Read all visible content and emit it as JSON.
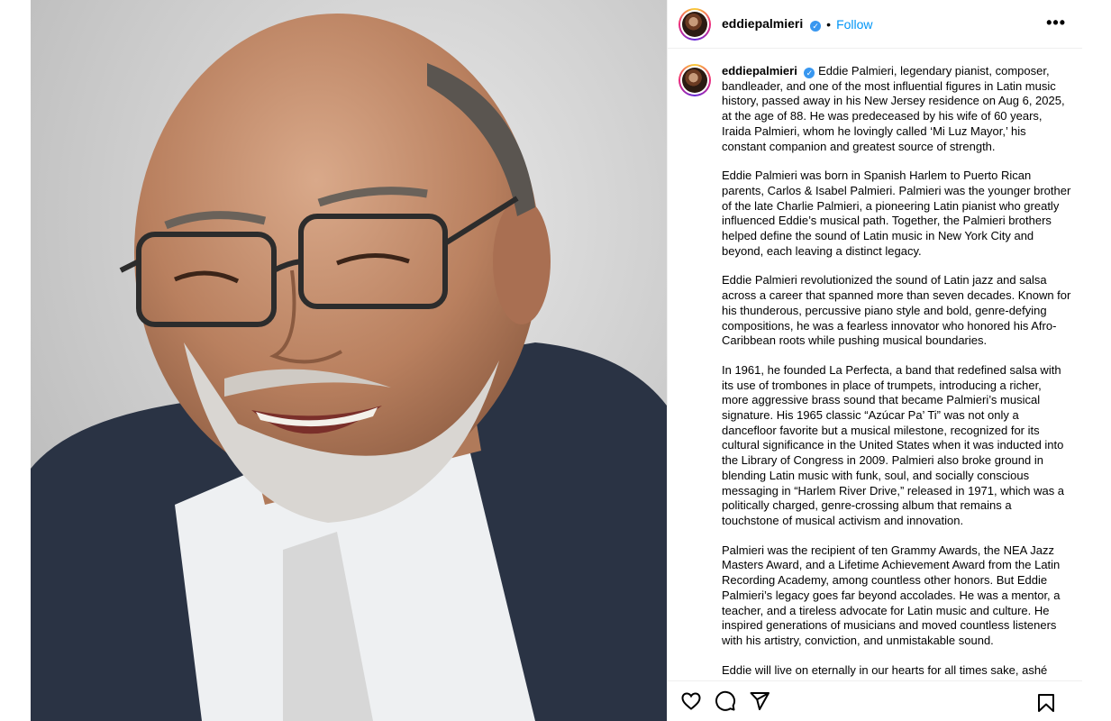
{
  "post": {
    "username": "eddiepalmieri",
    "verified_glyph": "✓",
    "separator": "•",
    "follow_label": "Follow",
    "more_label": "•••"
  },
  "caption": {
    "paragraphs": [
      "Eddie Palmieri, legendary pianist, composer, bandleader, and one of the most influential figures in Latin music history, passed away in his New Jersey residence on Aug 6, 2025, at the age of 88. He was predeceased by his wife of 60 years, Iraida Palmieri, whom he lovingly called ‘Mi Luz Mayor,’ his constant companion and greatest source of strength.",
      "Eddie Palmieri was born in Spanish Harlem to Puerto Rican parents, Carlos & Isabel Palmieri. Palmieri was the younger brother of the late Charlie Palmieri, a pioneering Latin pianist who greatly influenced Eddie’s musical path. Together, the Palmieri brothers helped define the sound of Latin music in New York City and beyond, each leaving a distinct legacy.",
      "Eddie Palmieri revolutionized the sound of Latin jazz and salsa across a career that spanned more than seven decades. Known for his thunderous, percussive piano style and bold, genre-defying compositions, he was a fearless innovator who honored his Afro-Caribbean roots while pushing musical boundaries.",
      "In 1961, he founded La Perfecta, a band that redefined salsa with its use of trombones in place of trumpets, introducing a richer, more aggressive brass sound that became Palmieri’s musical signature. His 1965 classic “Azúcar Pa’ Ti” was not only a dancefloor favorite but a musical milestone, recognized for its cultural significance in the United States when it was inducted into the Library of Congress in 2009. Palmieri also broke ground in blending Latin music with funk, soul, and socially conscious messaging in “Harlem River Drive,” released in 1971, which was a politically charged, genre-crossing album that remains a touchstone of musical activism and innovation.",
      "Palmieri was the recipient of ten Grammy Awards, the NEA Jazz Masters Award, and a Lifetime Achievement Award from the Latin Recording Academy, among countless other honors. But Eddie Palmieri’s legacy goes far beyond accolades. He was a mentor, a teacher, and a tireless advocate for Latin music and culture. He inspired generations of musicians and moved countless listeners with his artistry, conviction, and unmistakable sound.",
      "Eddie will live on eternally in our hearts for all times sake, ashé"
    ]
  },
  "icons": {
    "like": "heart-icon",
    "comment": "comment-bubble-icon",
    "share": "paper-plane-icon",
    "save": "bookmark-icon",
    "more": "more-horizontal-icon",
    "verified": "verified-badge-icon"
  },
  "colors": {
    "follow": "#0095f6",
    "verified": "#3897f0",
    "jacket": "#2a3344",
    "background": "#d8d8d8"
  }
}
